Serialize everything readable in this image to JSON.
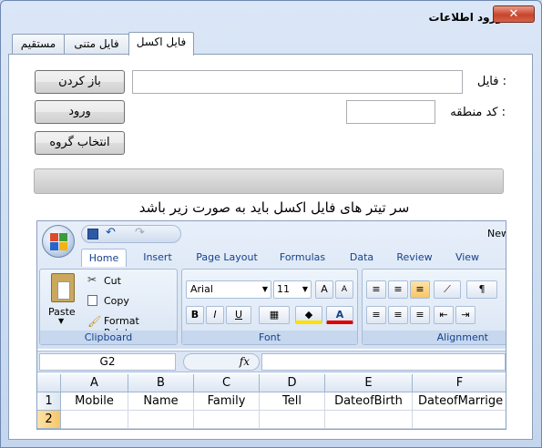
{
  "window": {
    "title": "ورود اطلاعات",
    "close_label": "✕"
  },
  "tabs": [
    {
      "label": "فایل اکسل",
      "active": true
    },
    {
      "label": "فایل متنی",
      "active": false
    },
    {
      "label": "مستقیم",
      "active": false
    }
  ],
  "form": {
    "open_button": "باز کردن",
    "import_button": "ورود",
    "select_group_button": "انتخاب گروه",
    "file_label": "فایل :",
    "file_value": "",
    "region_code_label": "کد منطقه :",
    "region_code_value": "",
    "progress": 0,
    "heading": "سر تیتر های فایل اکسل باید به صورت زیر باشد"
  },
  "excel": {
    "window_title_fragment": "New",
    "ribbon_tabs": [
      "Home",
      "Insert",
      "Page Layout",
      "Formulas",
      "Data",
      "Review",
      "View"
    ],
    "clipboard": {
      "paste": "Paste",
      "cut": "Cut",
      "copy": "Copy",
      "format_painter": "Format Painter",
      "group_label": "Clipboard"
    },
    "font": {
      "name": "Arial",
      "size": "11",
      "group_label": "Font",
      "bold": "B",
      "italic": "I",
      "underline": "U",
      "grow": "A",
      "shrink": "A"
    },
    "alignment": {
      "group_label": "Alignment"
    },
    "name_box": "G2",
    "fx": "fx",
    "columns": [
      "A",
      "B",
      "C",
      "D",
      "E",
      "F"
    ],
    "rows": [
      {
        "num": "1",
        "cells": [
          "Mobile",
          "Name",
          "Family",
          "Tell",
          "DateofBirth",
          "DateofMarrige"
        ]
      },
      {
        "num": "2",
        "cells": [
          "",
          "",
          "",
          "",
          "",
          ""
        ]
      }
    ]
  }
}
